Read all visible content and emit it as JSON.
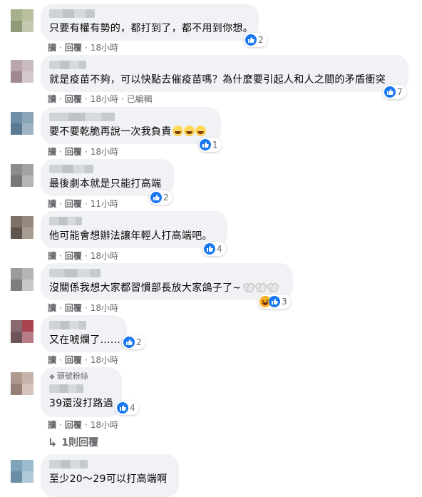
{
  "comments": [
    {
      "text": "只要有權有勢的，都打到了，都不用到你想。",
      "reactions": "2",
      "actions": {
        "read": "讀",
        "reply": "回覆",
        "time": "18小時",
        "extra": ""
      }
    },
    {
      "text": "就是疫苗不夠，可以快點去催疫苗嗎？為什麼要引起人和人之間的矛盾衝突",
      "reactions": "7",
      "actions": {
        "read": "讀",
        "reply": "回覆",
        "time": "18小時",
        "extra": "已編輯"
      }
    },
    {
      "text": "要不要乾脆再說一次我負責",
      "emojis": [
        "rofl-emoji",
        "rofl-emoji",
        "rofl-emoji"
      ],
      "reactions": "1",
      "actions": {
        "read": "讀",
        "reply": "回覆",
        "time": "18小時",
        "extra": ""
      }
    },
    {
      "text": "最後劇本就是只能打高端",
      "reactions": "2",
      "actions": {
        "read": "讀",
        "reply": "回覆",
        "time": "11小時",
        "extra": ""
      }
    },
    {
      "text": "他可能會想辦法讓年輕人打高端吧。",
      "reactions": "4",
      "actions": {
        "read": "讀",
        "reply": "回覆",
        "time": "18小時",
        "extra": ""
      }
    },
    {
      "text": "沒關係我想大家都習慣部長放大家鴿子了~",
      "emojis": [
        "clap-emoji",
        "clap-emoji",
        "clap-emoji"
      ],
      "reactions": "3",
      "reaction_types": [
        "haha-icon",
        "like-icon"
      ],
      "actions": {
        "read": "讀",
        "reply": "回覆",
        "time": "18小時",
        "extra": ""
      }
    },
    {
      "text": "又在唬爛了……",
      "reactions": "2",
      "actions": {
        "read": "讀",
        "reply": "回覆",
        "time": "18小時",
        "extra": ""
      }
    },
    {
      "badge": "頭號粉絲",
      "badge_icon": "diamond-icon",
      "text": "39還沒打路過",
      "reactions": "4",
      "actions": {
        "read": "讀",
        "reply": "回覆",
        "time": "18小時",
        "extra": ""
      }
    },
    {
      "text": "至少20～29可以打高端啊",
      "reactions": "",
      "actions": {
        "read": "",
        "reply": "",
        "time": "",
        "extra": ""
      }
    }
  ],
  "reply_toggle": {
    "label": "1則回覆",
    "icon": "reply-arrow-icon"
  },
  "colors": {
    "bubble": "#f0f2f5",
    "like_blue": "#1877f2",
    "meta_gray": "#65676b",
    "text": "#050505"
  }
}
